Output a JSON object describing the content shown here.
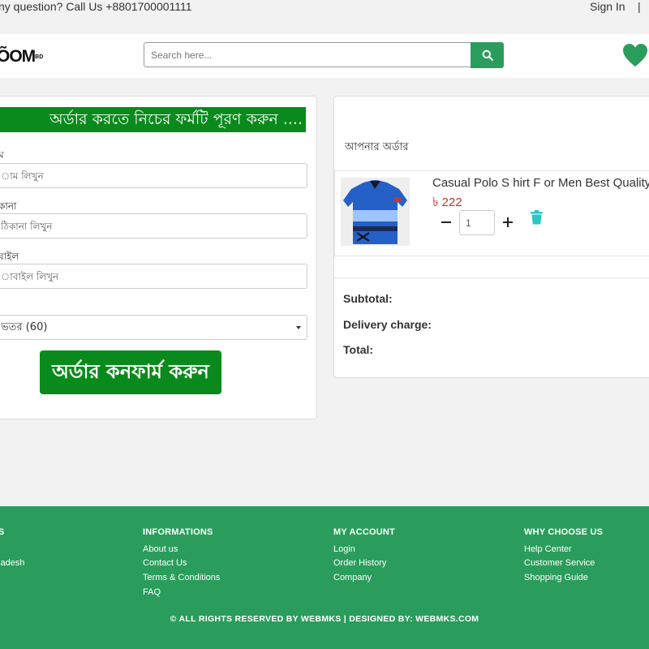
{
  "topbar": {
    "question": "ny question? Call Us +8801700001111",
    "signin": "Sign In",
    "separator": "|"
  },
  "header": {
    "logo": "ÕOM",
    "logo_small": "BD",
    "search_placeholder": "Search here...",
    "icons": {
      "search": "search-icon",
      "wishlist": "heart-icon"
    },
    "accent_color": "#2a9d5c"
  },
  "form": {
    "banner": "অর্ডার করতে নিচের ফর্মটি পূরণ করুন ....",
    "name_label": "ম",
    "name_placeholder": "াম লিখুন",
    "address_label": "কানা",
    "address_placeholder": "ঠিকানা লিখুন",
    "mobile_label": "বাইল",
    "mobile_placeholder": "াবাইল লিখুন",
    "area_label": "",
    "area_selected": "ভতর (60)",
    "confirm_button": "অর্ডার কনফার্ম করুন",
    "banner_color": "#0a8a1c"
  },
  "order": {
    "title": "আপনার অর্ডার",
    "item": {
      "name": "Casual Polo S hirt F or Men Best Quality",
      "price": "৳ 222",
      "quantity": "1"
    },
    "subtotal_label": "Subtotal:",
    "delivery_label": "Delivery charge:",
    "total_label": "Total:"
  },
  "footer": {
    "col1": {
      "heading": "S",
      "links": [
        "ladesh"
      ]
    },
    "col2": {
      "heading": "INFORMATIONS",
      "links": [
        "About us",
        "Contact Us",
        "Terms & Conditions",
        "FAQ"
      ]
    },
    "col3": {
      "heading": "MY ACCOUNT",
      "links": [
        "Login",
        "Order History",
        "Company"
      ]
    },
    "col4": {
      "heading": "WHY CHOOSE US",
      "links": [
        "Help Center",
        "Customer Service",
        "Shopping Guide"
      ]
    },
    "copyright": "© ALL RIGHTS RESERVED BY WEBMKS | DESIGNED BY: WEBMKS.COM"
  }
}
